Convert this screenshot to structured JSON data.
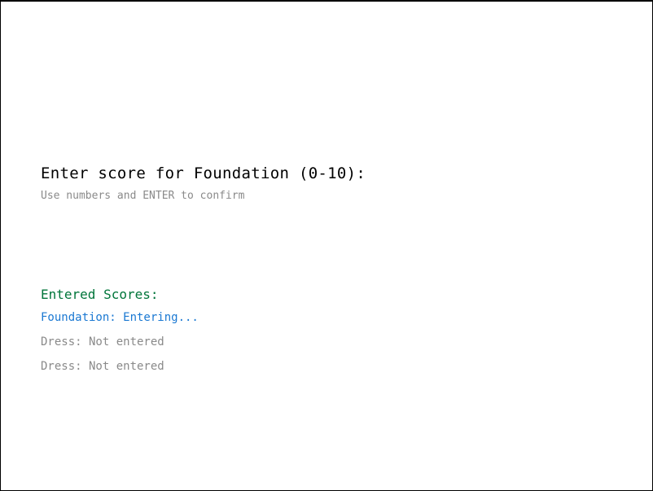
{
  "prompt": {
    "title": "Enter score for Foundation (0-10):",
    "hint": "Use numbers and ENTER to confirm"
  },
  "scores": {
    "heading": "Entered Scores:",
    "rows": [
      {
        "text": "Foundation: Entering...",
        "status": "entering",
        "color": "#1a78d2"
      },
      {
        "text": "Dress: Not entered",
        "status": "not-entered",
        "color": "#8a8a8a"
      },
      {
        "text": "Dress: Not entered",
        "status": "not-entered",
        "color": "#8a8a8a"
      }
    ]
  },
  "colors": {
    "background": "#ffffff",
    "frame": "#000000",
    "heading": "#00753a",
    "active": "#1a78d2",
    "muted": "#8a8a8a"
  }
}
